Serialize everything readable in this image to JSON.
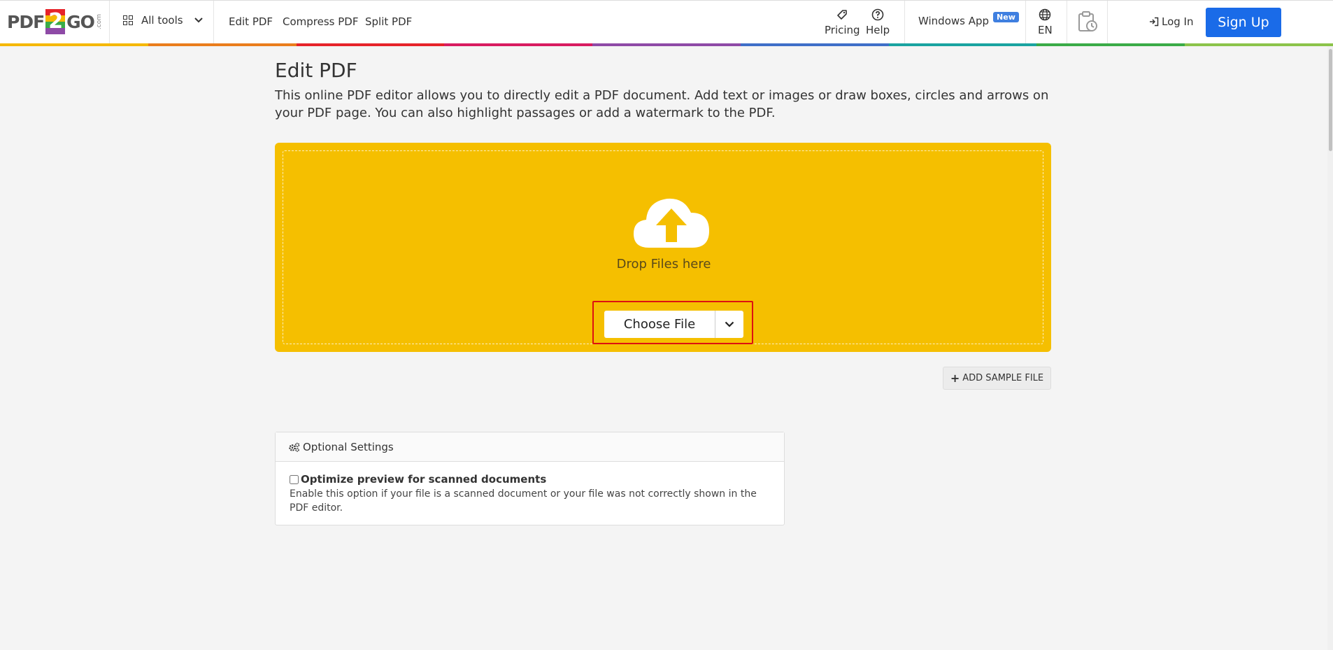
{
  "header": {
    "logo": {
      "left": "PDF",
      "two": "2",
      "right": "GO",
      "com": ".com"
    },
    "all_tools": "All tools",
    "nav": [
      "Edit PDF",
      "Compress PDF",
      "Split PDF"
    ],
    "pricing": "Pricing",
    "help": "Help",
    "windows_app": "Windows App",
    "new_badge": "New",
    "language": "EN",
    "login": "Log In",
    "signup": "Sign Up"
  },
  "rainbow_colors": [
    "#f5b800",
    "#ea7d1c",
    "#e6232a",
    "#d81b60",
    "#8e4aa6",
    "#3f6fc8",
    "#1aa3a0",
    "#3aab47",
    "#8bc34a"
  ],
  "main": {
    "title": "Edit PDF",
    "description": "This online PDF editor allows you to directly edit a PDF document. Add text or images or draw boxes, circles and arrows on your PDF page. You can also highlight passages or add a watermark to the PDF.",
    "drop_text": "Drop Files here",
    "choose_file": "Choose File",
    "add_sample": "ADD SAMPLE FILE"
  },
  "settings": {
    "header": "Optional Settings",
    "option_label": "Optimize preview for scanned documents",
    "option_checked": false,
    "option_help": "Enable this option if your file is a scanned document or your file was not correctly shown in the PDF editor."
  },
  "colors": {
    "accent_yellow": "#f5bf00",
    "signup_blue": "#1a6be8",
    "highlight_red": "#dd1111"
  }
}
